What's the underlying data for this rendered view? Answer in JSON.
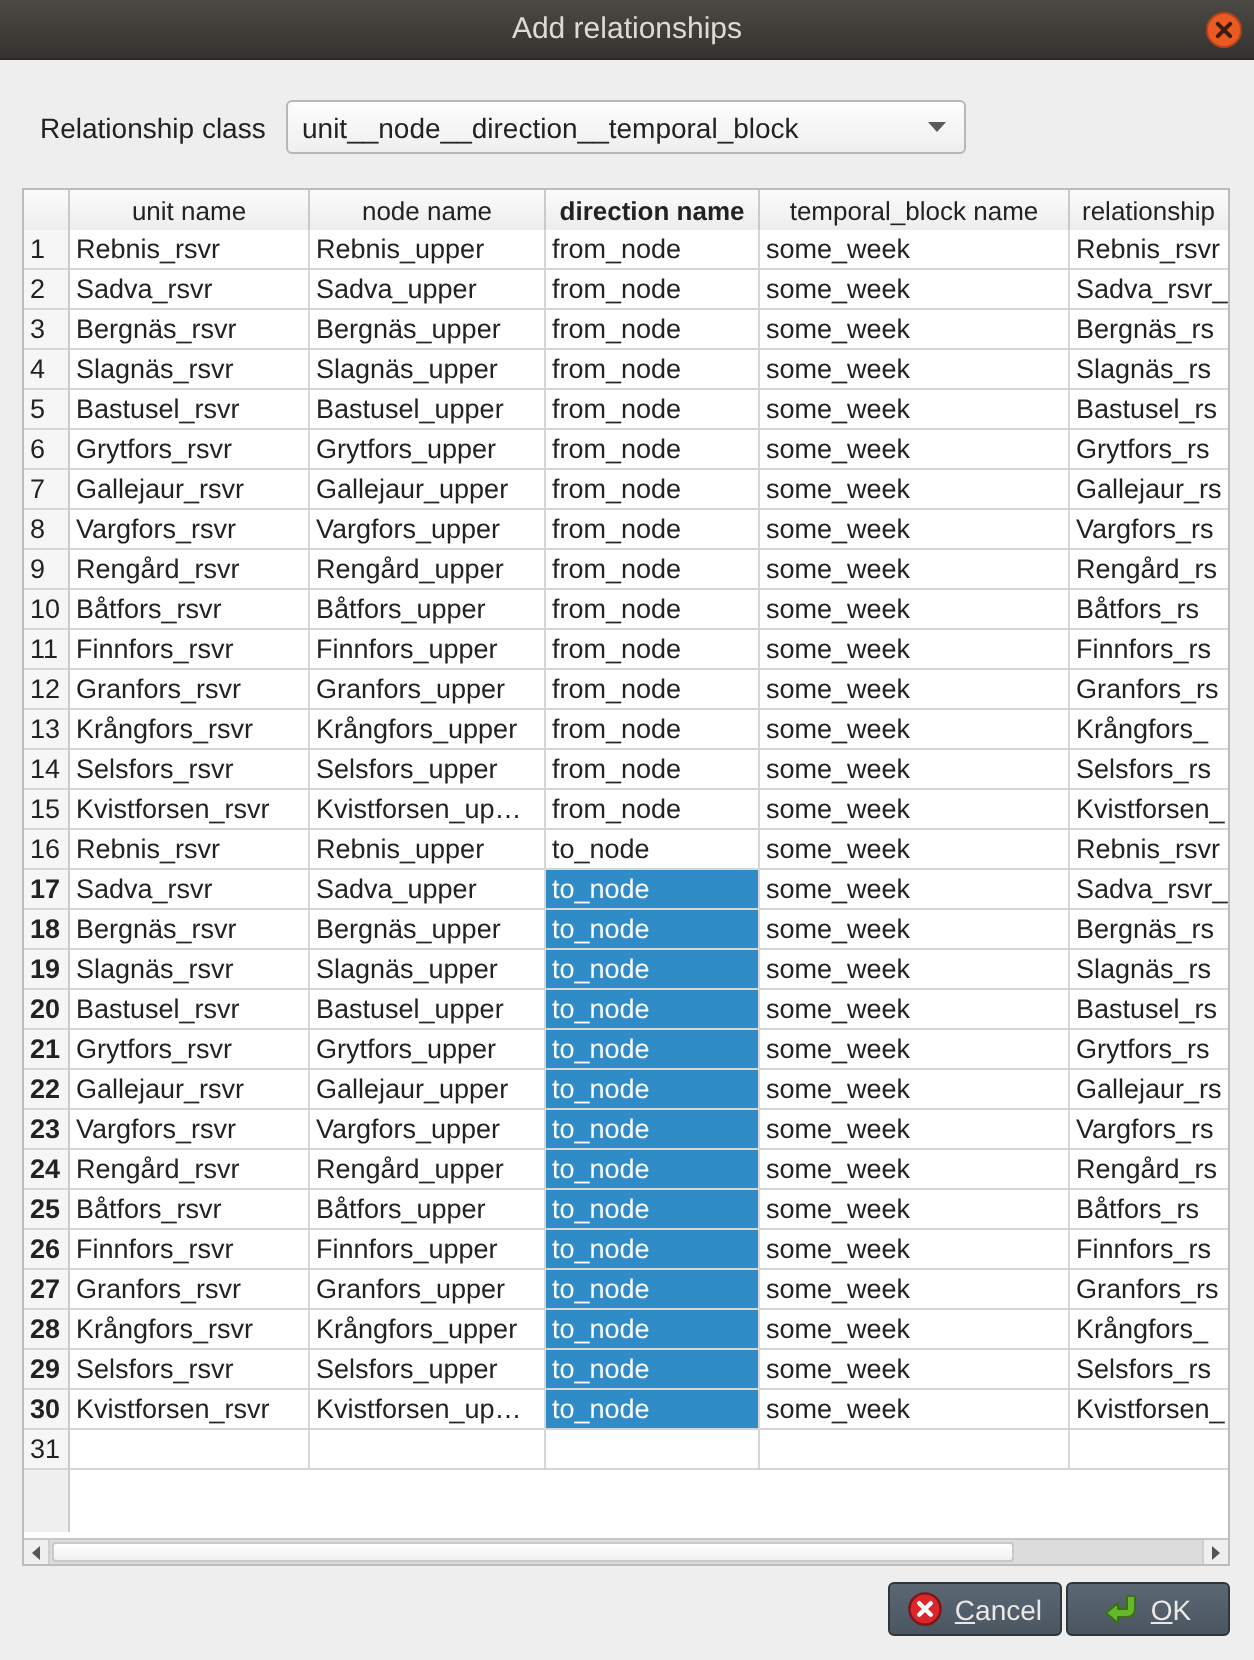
{
  "window": {
    "title": "Add relationships"
  },
  "relationship_class": {
    "label": "Relationship class",
    "value": "unit__node__direction__temporal_block"
  },
  "table": {
    "columns": [
      "unit name",
      "node name",
      "direction name",
      "temporal_block name",
      "relationship"
    ],
    "rows": [
      {
        "number": "1",
        "cells": [
          {
            "text": "Rebnis_rsvr",
            "selected": false
          },
          {
            "text": "Rebnis_upper",
            "selected": false
          },
          {
            "text": "from_node",
            "selected": false
          },
          {
            "text": "some_week",
            "selected": false
          },
          {
            "text": "Rebnis_rsvr",
            "selected": false
          }
        ]
      },
      {
        "number": "2",
        "cells": [
          {
            "text": "Sadva_rsvr",
            "selected": false
          },
          {
            "text": "Sadva_upper",
            "selected": false
          },
          {
            "text": "from_node",
            "selected": false
          },
          {
            "text": "some_week",
            "selected": false
          },
          {
            "text": "Sadva_rsvr_",
            "selected": false
          }
        ]
      },
      {
        "number": "3",
        "cells": [
          {
            "text": "Bergnäs_rsvr",
            "selected": false
          },
          {
            "text": "Bergnäs_upper",
            "selected": false
          },
          {
            "text": "from_node",
            "selected": false
          },
          {
            "text": "some_week",
            "selected": false
          },
          {
            "text": "Bergnäs_rs",
            "selected": false
          }
        ]
      },
      {
        "number": "4",
        "cells": [
          {
            "text": "Slagnäs_rsvr",
            "selected": false
          },
          {
            "text": "Slagnäs_upper",
            "selected": false
          },
          {
            "text": "from_node",
            "selected": false
          },
          {
            "text": "some_week",
            "selected": false
          },
          {
            "text": "Slagnäs_rs",
            "selected": false
          }
        ]
      },
      {
        "number": "5",
        "cells": [
          {
            "text": "Bastusel_rsvr",
            "selected": false
          },
          {
            "text": "Bastusel_upper",
            "selected": false
          },
          {
            "text": "from_node",
            "selected": false
          },
          {
            "text": "some_week",
            "selected": false
          },
          {
            "text": "Bastusel_rs",
            "selected": false
          }
        ]
      },
      {
        "number": "6",
        "cells": [
          {
            "text": "Grytfors_rsvr",
            "selected": false
          },
          {
            "text": "Grytfors_upper",
            "selected": false
          },
          {
            "text": "from_node",
            "selected": false
          },
          {
            "text": "some_week",
            "selected": false
          },
          {
            "text": "Grytfors_rs",
            "selected": false
          }
        ]
      },
      {
        "number": "7",
        "cells": [
          {
            "text": "Gallejaur_rsvr",
            "selected": false
          },
          {
            "text": "Gallejaur_upper",
            "selected": false
          },
          {
            "text": "from_node",
            "selected": false
          },
          {
            "text": "some_week",
            "selected": false
          },
          {
            "text": "Gallejaur_rs",
            "selected": false
          }
        ]
      },
      {
        "number": "8",
        "cells": [
          {
            "text": "Vargfors_rsvr",
            "selected": false
          },
          {
            "text": "Vargfors_upper",
            "selected": false
          },
          {
            "text": "from_node",
            "selected": false
          },
          {
            "text": "some_week",
            "selected": false
          },
          {
            "text": "Vargfors_rs",
            "selected": false
          }
        ]
      },
      {
        "number": "9",
        "cells": [
          {
            "text": "Rengård_rsvr",
            "selected": false
          },
          {
            "text": "Rengård_upper",
            "selected": false
          },
          {
            "text": "from_node",
            "selected": false
          },
          {
            "text": "some_week",
            "selected": false
          },
          {
            "text": "Rengård_rs",
            "selected": false
          }
        ]
      },
      {
        "number": "10",
        "cells": [
          {
            "text": "Båtfors_rsvr",
            "selected": false
          },
          {
            "text": "Båtfors_upper",
            "selected": false
          },
          {
            "text": "from_node",
            "selected": false
          },
          {
            "text": "some_week",
            "selected": false
          },
          {
            "text": "Båtfors_rs",
            "selected": false
          }
        ]
      },
      {
        "number": "11",
        "cells": [
          {
            "text": "Finnfors_rsvr",
            "selected": false
          },
          {
            "text": "Finnfors_upper",
            "selected": false
          },
          {
            "text": "from_node",
            "selected": false
          },
          {
            "text": "some_week",
            "selected": false
          },
          {
            "text": "Finnfors_rs",
            "selected": false
          }
        ]
      },
      {
        "number": "12",
        "cells": [
          {
            "text": "Granfors_rsvr",
            "selected": false
          },
          {
            "text": "Granfors_upper",
            "selected": false
          },
          {
            "text": "from_node",
            "selected": false
          },
          {
            "text": "some_week",
            "selected": false
          },
          {
            "text": "Granfors_rs",
            "selected": false
          }
        ]
      },
      {
        "number": "13",
        "cells": [
          {
            "text": "Krångfors_rsvr",
            "selected": false
          },
          {
            "text": "Krångfors_upper",
            "selected": false
          },
          {
            "text": "from_node",
            "selected": false
          },
          {
            "text": "some_week",
            "selected": false
          },
          {
            "text": "Krångfors_",
            "selected": false
          }
        ]
      },
      {
        "number": "14",
        "cells": [
          {
            "text": "Selsfors_rsvr",
            "selected": false
          },
          {
            "text": "Selsfors_upper",
            "selected": false
          },
          {
            "text": "from_node",
            "selected": false
          },
          {
            "text": "some_week",
            "selected": false
          },
          {
            "text": "Selsfors_rs",
            "selected": false
          }
        ]
      },
      {
        "number": "15",
        "cells": [
          {
            "text": "Kvistforsen_rsvr",
            "selected": false
          },
          {
            "text": "Kvistforsen_up…",
            "selected": false
          },
          {
            "text": "from_node",
            "selected": false
          },
          {
            "text": "some_week",
            "selected": false
          },
          {
            "text": "Kvistforsen_",
            "selected": false
          }
        ]
      },
      {
        "number": "16",
        "cells": [
          {
            "text": "Rebnis_rsvr",
            "selected": false
          },
          {
            "text": "Rebnis_upper",
            "selected": false
          },
          {
            "text": "to_node",
            "selected": false
          },
          {
            "text": "some_week",
            "selected": false
          },
          {
            "text": "Rebnis_rsvr",
            "selected": false
          }
        ]
      },
      {
        "number": "17",
        "cells": [
          {
            "text": "Sadva_rsvr",
            "selected": false
          },
          {
            "text": "Sadva_upper",
            "selected": false
          },
          {
            "text": "to_node",
            "selected": true
          },
          {
            "text": "some_week",
            "selected": false
          },
          {
            "text": "Sadva_rsvr_",
            "selected": false
          }
        ]
      },
      {
        "number": "18",
        "cells": [
          {
            "text": "Bergnäs_rsvr",
            "selected": false
          },
          {
            "text": "Bergnäs_upper",
            "selected": false
          },
          {
            "text": "to_node",
            "selected": true
          },
          {
            "text": "some_week",
            "selected": false
          },
          {
            "text": "Bergnäs_rs",
            "selected": false
          }
        ]
      },
      {
        "number": "19",
        "cells": [
          {
            "text": "Slagnäs_rsvr",
            "selected": false
          },
          {
            "text": "Slagnäs_upper",
            "selected": false
          },
          {
            "text": "to_node",
            "selected": true
          },
          {
            "text": "some_week",
            "selected": false
          },
          {
            "text": "Slagnäs_rs",
            "selected": false
          }
        ]
      },
      {
        "number": "20",
        "cells": [
          {
            "text": "Bastusel_rsvr",
            "selected": false
          },
          {
            "text": "Bastusel_upper",
            "selected": false
          },
          {
            "text": "to_node",
            "selected": true
          },
          {
            "text": "some_week",
            "selected": false
          },
          {
            "text": "Bastusel_rs",
            "selected": false
          }
        ]
      },
      {
        "number": "21",
        "cells": [
          {
            "text": "Grytfors_rsvr",
            "selected": false
          },
          {
            "text": "Grytfors_upper",
            "selected": false
          },
          {
            "text": "to_node",
            "selected": true
          },
          {
            "text": "some_week",
            "selected": false
          },
          {
            "text": "Grytfors_rs",
            "selected": false
          }
        ]
      },
      {
        "number": "22",
        "cells": [
          {
            "text": "Gallejaur_rsvr",
            "selected": false
          },
          {
            "text": "Gallejaur_upper",
            "selected": false
          },
          {
            "text": "to_node",
            "selected": true
          },
          {
            "text": "some_week",
            "selected": false
          },
          {
            "text": "Gallejaur_rs",
            "selected": false
          }
        ]
      },
      {
        "number": "23",
        "cells": [
          {
            "text": "Vargfors_rsvr",
            "selected": false
          },
          {
            "text": "Vargfors_upper",
            "selected": false
          },
          {
            "text": "to_node",
            "selected": true
          },
          {
            "text": "some_week",
            "selected": false
          },
          {
            "text": "Vargfors_rs",
            "selected": false
          }
        ]
      },
      {
        "number": "24",
        "cells": [
          {
            "text": "Rengård_rsvr",
            "selected": false
          },
          {
            "text": "Rengård_upper",
            "selected": false
          },
          {
            "text": "to_node",
            "selected": true
          },
          {
            "text": "some_week",
            "selected": false
          },
          {
            "text": "Rengård_rs",
            "selected": false
          }
        ]
      },
      {
        "number": "25",
        "cells": [
          {
            "text": "Båtfors_rsvr",
            "selected": false
          },
          {
            "text": "Båtfors_upper",
            "selected": false
          },
          {
            "text": "to_node",
            "selected": true
          },
          {
            "text": "some_week",
            "selected": false
          },
          {
            "text": "Båtfors_rs",
            "selected": false
          }
        ]
      },
      {
        "number": "26",
        "cells": [
          {
            "text": "Finnfors_rsvr",
            "selected": false
          },
          {
            "text": "Finnfors_upper",
            "selected": false
          },
          {
            "text": "to_node",
            "selected": true
          },
          {
            "text": "some_week",
            "selected": false
          },
          {
            "text": "Finnfors_rs",
            "selected": false
          }
        ]
      },
      {
        "number": "27",
        "cells": [
          {
            "text": "Granfors_rsvr",
            "selected": false
          },
          {
            "text": "Granfors_upper",
            "selected": false
          },
          {
            "text": "to_node",
            "selected": true
          },
          {
            "text": "some_week",
            "selected": false
          },
          {
            "text": "Granfors_rs",
            "selected": false
          }
        ]
      },
      {
        "number": "28",
        "cells": [
          {
            "text": "Krångfors_rsvr",
            "selected": false
          },
          {
            "text": "Krångfors_upper",
            "selected": false
          },
          {
            "text": "to_node",
            "selected": true
          },
          {
            "text": "some_week",
            "selected": false
          },
          {
            "text": "Krångfors_",
            "selected": false
          }
        ]
      },
      {
        "number": "29",
        "cells": [
          {
            "text": "Selsfors_rsvr",
            "selected": false
          },
          {
            "text": "Selsfors_upper",
            "selected": false
          },
          {
            "text": "to_node",
            "selected": true
          },
          {
            "text": "some_week",
            "selected": false
          },
          {
            "text": "Selsfors_rs",
            "selected": false
          }
        ]
      },
      {
        "number": "30",
        "cells": [
          {
            "text": "Kvistforsen_rsvr",
            "selected": false
          },
          {
            "text": "Kvistforsen_up…",
            "selected": false
          },
          {
            "text": "to_node",
            "selected": true
          },
          {
            "text": "some_week",
            "selected": false
          },
          {
            "text": "Kvistforsen_",
            "selected": false
          }
        ]
      },
      {
        "number": "31"
      }
    ]
  },
  "buttons": [
    {
      "kind": "cancel",
      "label": "Cancel"
    },
    {
      "kind": "ok",
      "label": "OK"
    }
  ]
}
